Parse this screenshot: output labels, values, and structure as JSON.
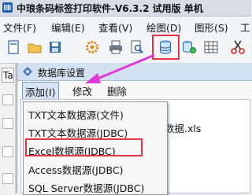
{
  "window": {
    "title": "中琅条码标签打印软件-V6.3.2 试用版 单机"
  },
  "menubar": {
    "items": [
      "文件(F)",
      "编辑(E)",
      "查看(V)",
      "绘图(D)",
      "图形(S)",
      "工"
    ]
  },
  "toolbar": {
    "icons": [
      "new-file-icon",
      "open-folder-icon",
      "save-icon",
      "settings-gear-icon",
      "print-icon",
      "print-preview-icon",
      "database-icon",
      "database-settings-icon",
      "barcode-grid-icon",
      "cut-icon"
    ],
    "highlight_color": "#e63346"
  },
  "left_strip": {
    "input_value": "Ta"
  },
  "dialog": {
    "title": "数据库设置",
    "menu": [
      "添加(I)",
      "修改",
      "删除"
    ],
    "content_text": "数据.xls"
  },
  "dropdown": {
    "items": [
      "TXT文本数据源(文件)",
      "TXT文本数据源(JDBC)",
      "Excel数据源(JDBC)",
      "Access数据源(JDBC)",
      "SQL Server数据源(JDBC)"
    ]
  },
  "arrow_color": "#e03ad6"
}
